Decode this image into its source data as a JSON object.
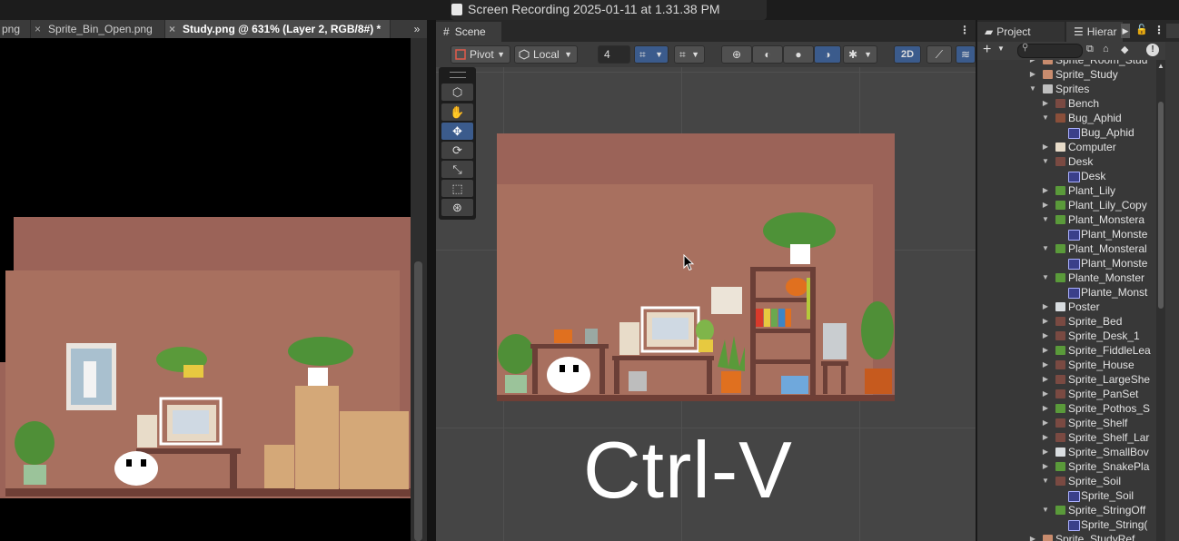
{
  "recording": {
    "title": "Screen Recording 2025-01-11 at 1.31.38 PM"
  },
  "photoshop": {
    "tabs": [
      {
        "label": "png",
        "close": ""
      },
      {
        "label": "Sprite_Bin_Open.png",
        "close": "×"
      },
      {
        "label": "Study.png @ 631% (Layer 2, RGB/8#) *",
        "close": "×"
      }
    ],
    "overflow": "»"
  },
  "scene": {
    "tab_label": "Scene",
    "menu": "⋮",
    "pivot_label": "Pivot",
    "space_label": "Local",
    "grid_value": "4",
    "mode_2d": "2D",
    "overlay_text": "Ctrl-V"
  },
  "tools": [
    "hand",
    "move",
    "rotate",
    "scale",
    "rect",
    "transform"
  ],
  "hierarchy": {
    "project_tab": "Project",
    "hierarchy_tab": "Hierar",
    "items": [
      {
        "label": "Sprite_Room_Stud",
        "depth": 0,
        "arrow": "▶",
        "icon": "sprite-group"
      },
      {
        "label": "Sprite_Study",
        "depth": 0,
        "arrow": "▶",
        "icon": "sprite-group"
      },
      {
        "label": "Sprites",
        "depth": 0,
        "arrow": "▼",
        "icon": "folder"
      },
      {
        "label": "Bench",
        "depth": 1,
        "arrow": "▶",
        "icon": "sprite-line"
      },
      {
        "label": "Bug_Aphid",
        "depth": 1,
        "arrow": "▼",
        "icon": "sprite-bug"
      },
      {
        "label": "Bug_Aphid",
        "depth": 2,
        "arrow": "",
        "icon": "sprite-asset"
      },
      {
        "label": "Computer",
        "depth": 1,
        "arrow": "▶",
        "icon": "sprite-computer"
      },
      {
        "label": "Desk",
        "depth": 1,
        "arrow": "▼",
        "icon": "sprite-line"
      },
      {
        "label": "Desk",
        "depth": 2,
        "arrow": "",
        "icon": "sprite-asset"
      },
      {
        "label": "Plant_Lily",
        "depth": 1,
        "arrow": "▶",
        "icon": "sprite-plant"
      },
      {
        "label": "Plant_Lily_Copy",
        "depth": 1,
        "arrow": "▶",
        "icon": "sprite-plant"
      },
      {
        "label": "Plant_Monstera",
        "depth": 1,
        "arrow": "▼",
        "icon": "sprite-plant"
      },
      {
        "label": "Plant_Monste",
        "depth": 2,
        "arrow": "",
        "icon": "sprite-asset"
      },
      {
        "label": "Plant_Monsteral",
        "depth": 1,
        "arrow": "▼",
        "icon": "sprite-plant"
      },
      {
        "label": "Plant_Monste",
        "depth": 2,
        "arrow": "",
        "icon": "sprite-asset"
      },
      {
        "label": "Plante_Monster",
        "depth": 1,
        "arrow": "▼",
        "icon": "sprite-plant"
      },
      {
        "label": "Plante_Monst",
        "depth": 2,
        "arrow": "",
        "icon": "sprite-asset"
      },
      {
        "label": "Poster",
        "depth": 1,
        "arrow": "▶",
        "icon": "sprite-poster"
      },
      {
        "label": "Sprite_Bed",
        "depth": 1,
        "arrow": "▶",
        "icon": "sprite-line"
      },
      {
        "label": "Sprite_Desk_1",
        "depth": 1,
        "arrow": "▶",
        "icon": "sprite-line"
      },
      {
        "label": "Sprite_FiddleLea",
        "depth": 1,
        "arrow": "▶",
        "icon": "sprite-plant"
      },
      {
        "label": "Sprite_House",
        "depth": 1,
        "arrow": "▶",
        "icon": "sprite-line"
      },
      {
        "label": "Sprite_LargeShe",
        "depth": 1,
        "arrow": "▶",
        "icon": "sprite-line"
      },
      {
        "label": "Sprite_PanSet",
        "depth": 1,
        "arrow": "▶",
        "icon": "sprite-line"
      },
      {
        "label": "Sprite_Pothos_S",
        "depth": 1,
        "arrow": "▶",
        "icon": "sprite-plant"
      },
      {
        "label": "Sprite_Shelf",
        "depth": 1,
        "arrow": "▶",
        "icon": "sprite-line"
      },
      {
        "label": "Sprite_Shelf_Lar",
        "depth": 1,
        "arrow": "▶",
        "icon": "sprite-line"
      },
      {
        "label": "Sprite_SmallBov",
        "depth": 1,
        "arrow": "▶",
        "icon": "sprite-poster"
      },
      {
        "label": "Sprite_SnakePla",
        "depth": 1,
        "arrow": "▶",
        "icon": "sprite-plant"
      },
      {
        "label": "Sprite_Soil",
        "depth": 1,
        "arrow": "▼",
        "icon": "sprite-line"
      },
      {
        "label": "Sprite_Soil",
        "depth": 2,
        "arrow": "",
        "icon": "sprite-asset"
      },
      {
        "label": "Sprite_StringOff",
        "depth": 1,
        "arrow": "▼",
        "icon": "sprite-plant"
      },
      {
        "label": "Sprite_String(",
        "depth": 2,
        "arrow": "",
        "icon": "sprite-asset"
      },
      {
        "label": "Sprite_StudyRef",
        "depth": 0,
        "arrow": "▶",
        "icon": "sprite-group"
      }
    ]
  },
  "colors": {
    "accent_blue": "#3b5b8c",
    "wall_dark": "#9b6358",
    "wall_light": "#a8705f"
  }
}
